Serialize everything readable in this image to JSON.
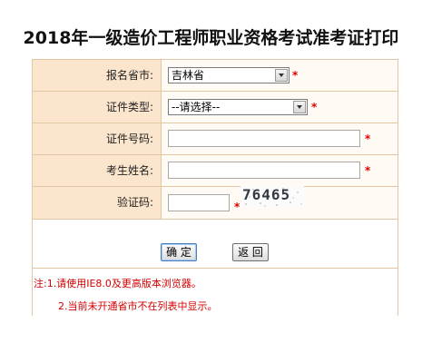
{
  "page": {
    "title": "2018年一级造价工程师职业资格考试准考证打印"
  },
  "form": {
    "province": {
      "label": "报名省市:",
      "value": "吉林省",
      "required": "*"
    },
    "id_type": {
      "label": "证件类型:",
      "value": "--请选择--",
      "required": "*"
    },
    "id_number": {
      "label": "证件号码:",
      "value": "",
      "required": "*"
    },
    "name": {
      "label": "考生姓名:",
      "value": "",
      "required": "*"
    },
    "captcha": {
      "label": "验证码:",
      "value": "",
      "required": "*",
      "image_text": "76465"
    },
    "buttons": {
      "confirm": "确 定",
      "back": "返 回"
    }
  },
  "notes": {
    "line1": "注:1.请使用IE8.0及更高版本浏览器。",
    "line2": "2.当前未开通省市不在列表中显示。"
  },
  "colors": {
    "label_bg": "#fbe6cd",
    "border": "#e3c7a4",
    "required": "#e00000",
    "note": "#d40000"
  }
}
